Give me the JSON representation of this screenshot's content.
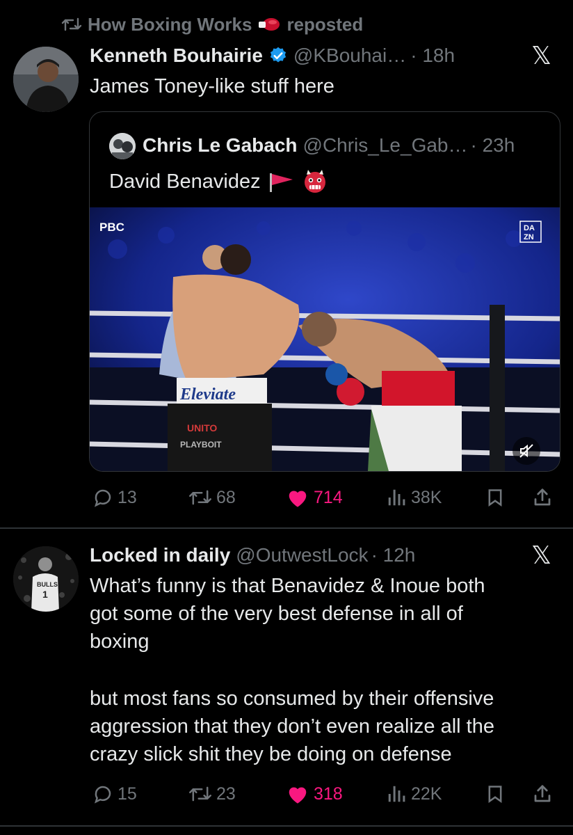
{
  "repost": {
    "text": "How Boxing Works",
    "suffix": "reposted"
  },
  "tweet1": {
    "name": "Kenneth Bouhairie",
    "handle": "@KBouhai…",
    "time": "· 18h",
    "text": "James Toney-like stuff here",
    "quote": {
      "name": "Chris Le Gabach",
      "handle": "@Chris_Le_Gab…",
      "time": "· 23h",
      "text": "David Benavidez",
      "video": {
        "network_left": "PBC",
        "network_right_1": "DA",
        "network_right_2": "ZN",
        "trunks_text": "Eleviate",
        "trunks_text2": "UNITO",
        "trunks_text3": "PLAYBOIT"
      }
    },
    "actions": {
      "replies": "13",
      "reposts": "68",
      "likes": "714",
      "views": "38K"
    }
  },
  "tweet2": {
    "name": "Locked in daily",
    "handle": "@OutwestLock",
    "time": "· 12h",
    "lines": [
      "What’s funny is that Benavidez & Inoue both",
      "got some of the very best defense in all of",
      "boxing",
      "but most fans so consumed by their offensive",
      "aggression that they don’t even realize all the",
      "crazy slick shit they be doing on defense"
    ],
    "actions": {
      "replies": "15",
      "reposts": "23",
      "likes": "318",
      "views": "22K"
    }
  },
  "colors": {
    "like": "#f91880",
    "verified": "#1d9bf0",
    "muted": "#71767b",
    "text": "#e7e9ea"
  }
}
